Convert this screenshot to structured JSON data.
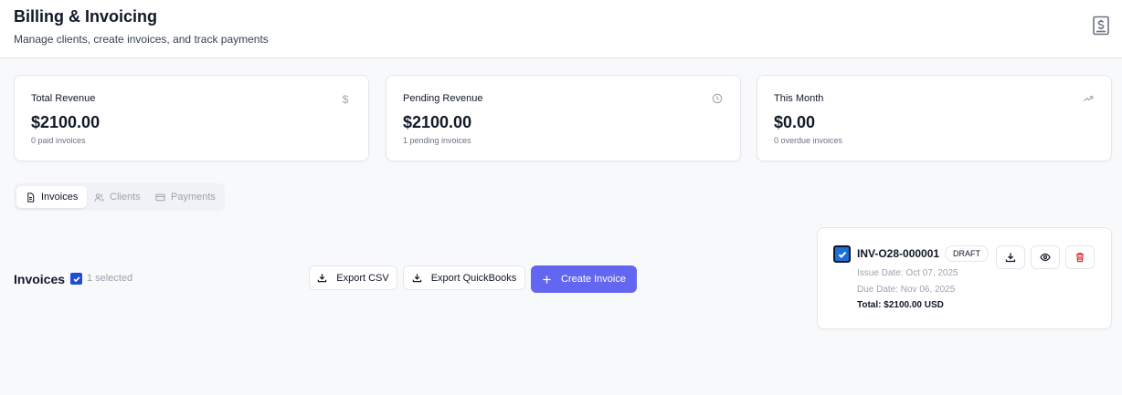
{
  "header": {
    "title": "Billing & Invoicing",
    "subtitle": "Manage clients, create invoices, and track payments",
    "icon": "dollar-receipt-icon"
  },
  "stats": [
    {
      "label": "Total Revenue",
      "value": "$2100.00",
      "sub": "0 paid invoices",
      "icon": "dollar-icon"
    },
    {
      "label": "Pending Revenue",
      "value": "$2100.00",
      "sub": "1 pending invoices",
      "icon": "clock-icon"
    },
    {
      "label": "This Month",
      "value": "$0.00",
      "sub": "0 overdue invoices",
      "icon": "trending-up-icon"
    }
  ],
  "tabs": [
    {
      "label": "Invoices",
      "icon": "document-icon",
      "active": true
    },
    {
      "label": "Clients",
      "icon": "users-icon",
      "active": false
    },
    {
      "label": "Payments",
      "icon": "credit-card-icon",
      "active": false
    }
  ],
  "invoices_section": {
    "title": "Invoices",
    "selected_text": "1 selected",
    "export_csv_label": "Export CSV",
    "export_quickbooks_label": "Export QuickBooks",
    "create_label": "Create Invoice"
  },
  "invoice": {
    "number": "INV-O28-000001",
    "status": "DRAFT",
    "issue_date": "Issue Date: Oct 07, 2025",
    "due_date": "Due Date: Nov 06, 2025",
    "total": "Total: $2100.00 USD",
    "checked": true
  },
  "colors": {
    "primary": "#6366f1",
    "checkbox": "#1d6fd8",
    "delete": "#dc2626",
    "muted": "#9ca3af"
  }
}
